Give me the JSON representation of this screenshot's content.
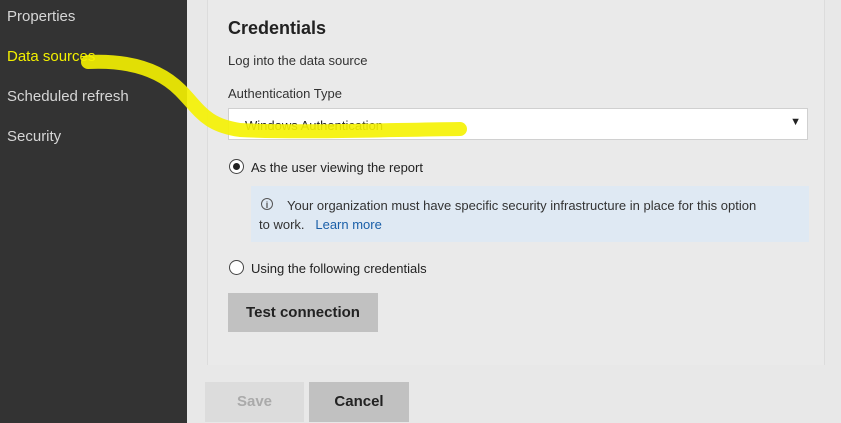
{
  "sidebar": {
    "items": [
      {
        "label": "Properties",
        "active": false
      },
      {
        "label": "Data sources",
        "active": true
      },
      {
        "label": "Scheduled refresh",
        "active": false
      },
      {
        "label": "Security",
        "active": false
      }
    ]
  },
  "credentials": {
    "title": "Credentials",
    "subtitle": "Log into the data source",
    "auth_type_label": "Authentication Type",
    "auth_type_value": "Windows Authentication",
    "option_viewer": "As the user viewing the report",
    "info_text_line1": "Your organization must have specific security infrastructure in place for this option",
    "info_text_line2": "to work.",
    "learn_more": "Learn more",
    "option_credentials": "Using the following credentials",
    "test_connection": "Test connection"
  },
  "footer": {
    "save": "Save",
    "cancel": "Cancel"
  },
  "colors": {
    "sidebar_bg": "#333333",
    "active_item": "#f3f000",
    "highlight_marker": "#f5f200"
  }
}
